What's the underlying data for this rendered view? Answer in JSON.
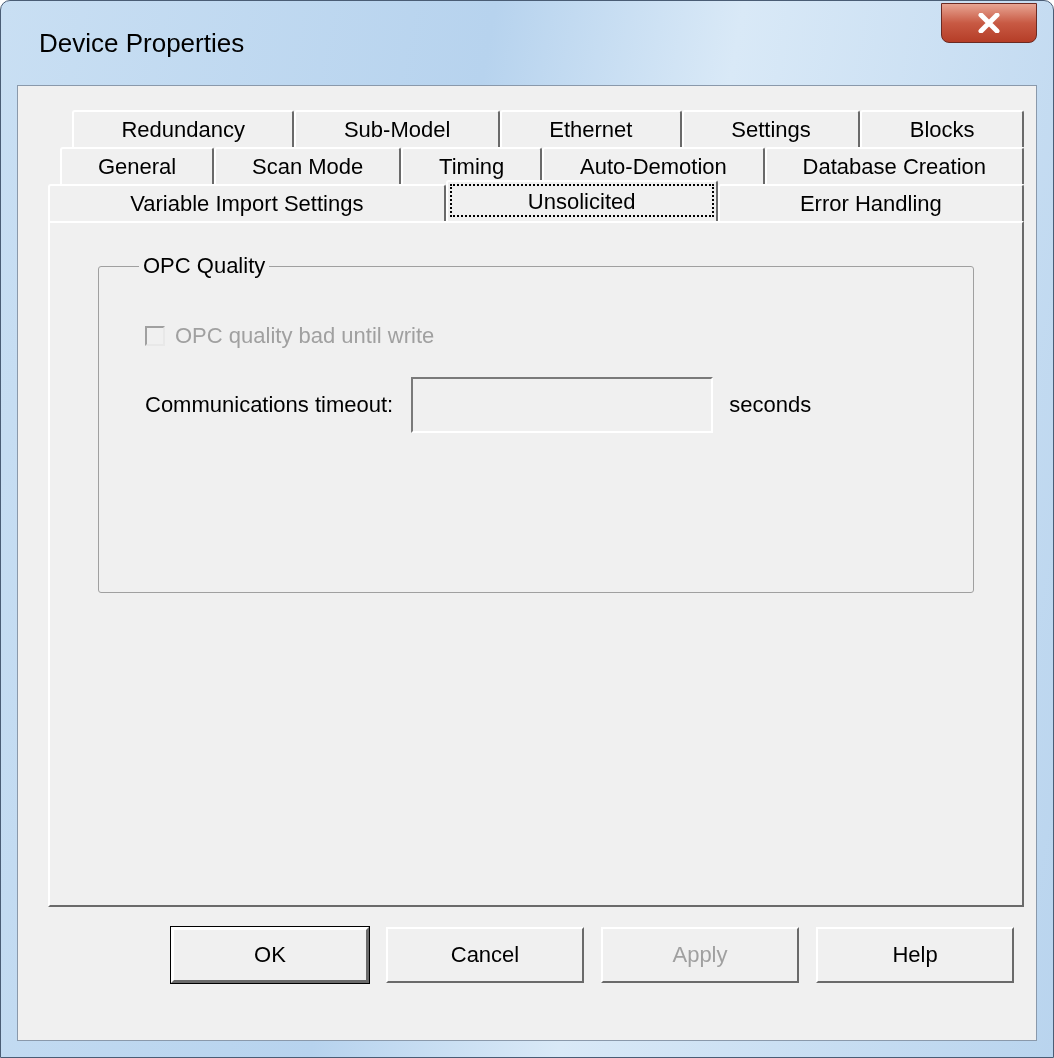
{
  "window": {
    "title": "Device Properties"
  },
  "tab_rows": [
    {
      "tabs": [
        {
          "label": "Redundancy",
          "selected": false
        },
        {
          "label": "Sub-Model",
          "selected": false
        },
        {
          "label": "Ethernet",
          "selected": false
        },
        {
          "label": "Settings",
          "selected": false
        },
        {
          "label": "Blocks",
          "selected": false
        }
      ]
    },
    {
      "tabs": [
        {
          "label": "General",
          "selected": false
        },
        {
          "label": "Scan Mode",
          "selected": false
        },
        {
          "label": "Timing",
          "selected": false
        },
        {
          "label": "Auto-Demotion",
          "selected": false
        },
        {
          "label": "Database Creation",
          "selected": false
        }
      ]
    },
    {
      "tabs": [
        {
          "label": "Variable Import Settings",
          "selected": false
        },
        {
          "label": "Unsolicited",
          "selected": true
        },
        {
          "label": "Error Handling",
          "selected": false
        }
      ]
    }
  ],
  "group": {
    "title": "OPC Quality",
    "checkbox": {
      "label": "OPC quality bad until write",
      "checked": false,
      "disabled": true
    },
    "timeout": {
      "label": "Communications timeout:",
      "unit": "seconds",
      "disabled": true
    }
  },
  "buttons": [
    {
      "label": "OK",
      "disabled": false,
      "default": true
    },
    {
      "label": "Cancel",
      "disabled": false,
      "default": false
    },
    {
      "label": "Apply",
      "disabled": true,
      "default": false
    },
    {
      "label": "Help",
      "disabled": false,
      "default": false
    }
  ]
}
